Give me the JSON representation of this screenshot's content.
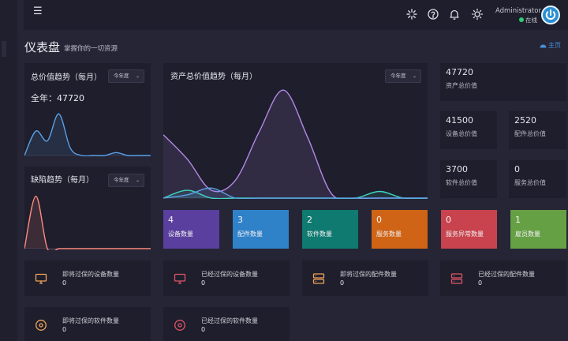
{
  "header": {
    "user_name": "Administrator",
    "user_status": "在线",
    "icons": [
      "menu-icon",
      "spinner-icon",
      "help-icon",
      "bell-icon",
      "sun-icon",
      "power-icon"
    ]
  },
  "page": {
    "title": "仪表盘",
    "subtitle": "掌握你的一切资源",
    "breadcrumb": "主页"
  },
  "panels": {
    "total_trend": {
      "title": "总价值趋势（每月）",
      "select": "今年度",
      "total_label": "全年：47720"
    },
    "defect_trend": {
      "title": "缺陷趋势（每月）",
      "select": "今年度"
    },
    "asset_trend": {
      "title": "资产总价值趋势（每月）",
      "select": "今年度"
    }
  },
  "stats": [
    {
      "value": "47720",
      "label": "资产总价值"
    },
    {
      "value": "41500",
      "label": "设备总价值"
    },
    {
      "value": "2520",
      "label": "配件总价值"
    },
    {
      "value": "3700",
      "label": "软件总价值"
    },
    {
      "value": "0",
      "label": "服务总价值"
    }
  ],
  "tiles": [
    {
      "value": "4",
      "label": "设备数量",
      "color": "#5a3f9e"
    },
    {
      "value": "3",
      "label": "配件数量",
      "color": "#2f82c8"
    },
    {
      "value": "2",
      "label": "软件数量",
      "color": "#0f7a70"
    },
    {
      "value": "0",
      "label": "服务数量",
      "color": "#cf6416"
    },
    {
      "value": "0",
      "label": "服务异常数量",
      "color": "#c8434d"
    },
    {
      "value": "1",
      "label": "雇员数量",
      "color": "#66a045"
    }
  ],
  "infos": [
    {
      "label": "即将过保的设备数量",
      "value": "0",
      "icon": "monitor-icon",
      "color": "#f0a45a"
    },
    {
      "label": "已经过保的设备数量",
      "value": "0",
      "icon": "monitor-icon",
      "color": "#e05464"
    },
    {
      "label": "即将过保的配件数量",
      "value": "0",
      "icon": "server-icon",
      "color": "#f0a45a"
    },
    {
      "label": "已经过保的配件数量",
      "value": "0",
      "icon": "server-icon",
      "color": "#e05464"
    },
    {
      "label": "即将过保的软件数量",
      "value": "0",
      "icon": "disc-icon",
      "color": "#f0a45a"
    },
    {
      "label": "已经过保的软件数量",
      "value": "0",
      "icon": "disc-icon",
      "color": "#e05464"
    }
  ],
  "chart_data": [
    {
      "type": "area",
      "series": [
        {
          "color": "#5aa0e6",
          "values": [
            0.0,
            0.5,
            0.3,
            0.85,
            0.15,
            0.0,
            0.0,
            0.0,
            0.06,
            0.0,
            0.0,
            0.0
          ]
        }
      ]
    },
    {
      "type": "area",
      "series": [
        {
          "color": "#ff8a80",
          "values": [
            0.0,
            0.9,
            0.0,
            0.0,
            0.0,
            0.0,
            0.0,
            0.0,
            0.0,
            0.0,
            0.0,
            0.0
          ]
        }
      ]
    },
    {
      "type": "area",
      "series": [
        {
          "color": "#b488e6",
          "values": [
            0.57,
            0.35,
            0.07,
            0.16,
            0.6,
            0.97,
            0.55,
            0.04,
            0.0,
            0.0,
            0.0,
            0.0
          ]
        },
        {
          "color": "#3fd4c0",
          "values": [
            0.0,
            0.07,
            0.0,
            0.0,
            0.0,
            0.0,
            0.0,
            0.0,
            0.0,
            0.06,
            0.0,
            0.0
          ]
        },
        {
          "color": "#5aa0e6",
          "values": [
            0.0,
            0.03,
            0.09,
            0.0,
            0.0,
            0.0,
            0.0,
            0.0,
            0.0,
            0.0,
            0.0,
            0.0
          ]
        }
      ]
    }
  ]
}
